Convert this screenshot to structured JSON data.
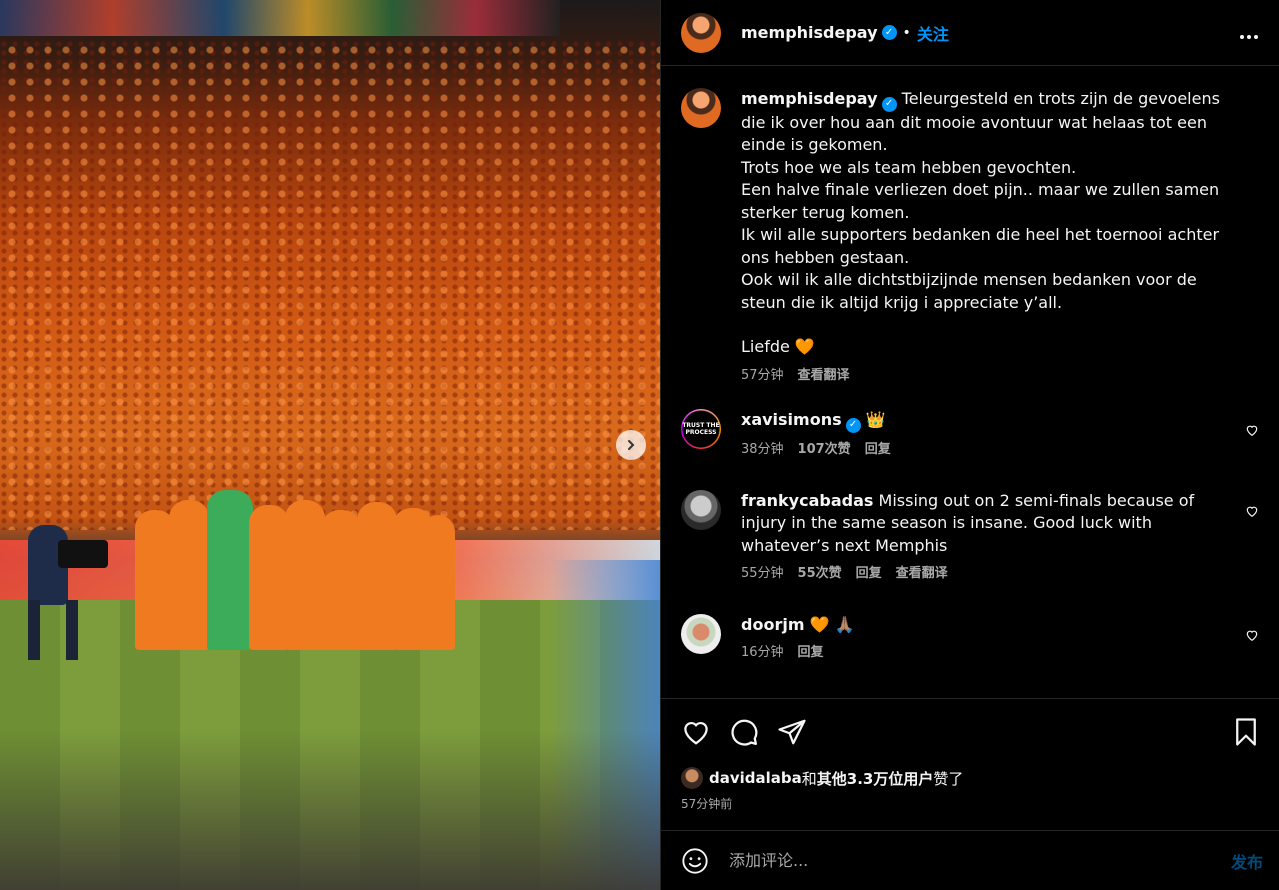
{
  "post": {
    "author": "memphisdepay",
    "follow_label": "关注",
    "separator": "•",
    "more_icon": "more-horizontal-icon",
    "next_icon": "chevron-right-icon"
  },
  "caption": {
    "author": "memphisdepay",
    "lines": [
      "Teleurgesteld en trots zijn de gevoelens die ik over hou aan dit mooie avontuur wat helaas tot een einde is gekomen.",
      "Trots hoe we als team hebben gevochten.",
      "Een halve finale verliezen doet pijn.. maar we zullen samen sterker terug komen.",
      "Ik wil alle supporters bedanken die heel het toernooi achter ons hebben gestaan.",
      "Ook wil ik alle dichtstbijzijnde mensen bedanken voor de steun die ik altijd krijg i appreciate y’all."
    ],
    "signoff": "Liefde 🧡",
    "time": "57分钟",
    "translate_label": "查看翻译"
  },
  "comments": [
    {
      "user": "xavisimons",
      "verified": true,
      "text": "👑",
      "time": "38分钟",
      "likes": "107次赞",
      "reply_label": "回复",
      "avatar_text": "TRUST THE PROCESS"
    },
    {
      "user": "frankycabadas",
      "text": "Missing out on 2 semi-finals because of injury in the same season is insane. Good luck with whatever’s next Memphis",
      "time": "55分钟",
      "likes": "55次赞",
      "reply_label": "回复",
      "translate_label": "查看翻译"
    },
    {
      "user": "doorjm",
      "text": "🧡 🙏🏽",
      "time": "16分钟",
      "reply_label": "回复"
    }
  ],
  "actions": {
    "like_icon": "heart-icon",
    "comment_icon": "comment-bubble-icon",
    "share_icon": "paper-plane-icon",
    "save_icon": "bookmark-icon",
    "likes_user": "davidalaba",
    "likes_joiner": "和",
    "likes_others": "其他3.3万位用户",
    "likes_suffix": "赞了",
    "time_ago": "57分钟前"
  },
  "composer": {
    "emoji_icon": "smiley-icon",
    "placeholder": "添加评论...",
    "post_label": "发布"
  },
  "colors": {
    "accent": "#0095f6",
    "background": "#000000",
    "border": "#262626",
    "secondary_text": "#a8a8a8"
  }
}
